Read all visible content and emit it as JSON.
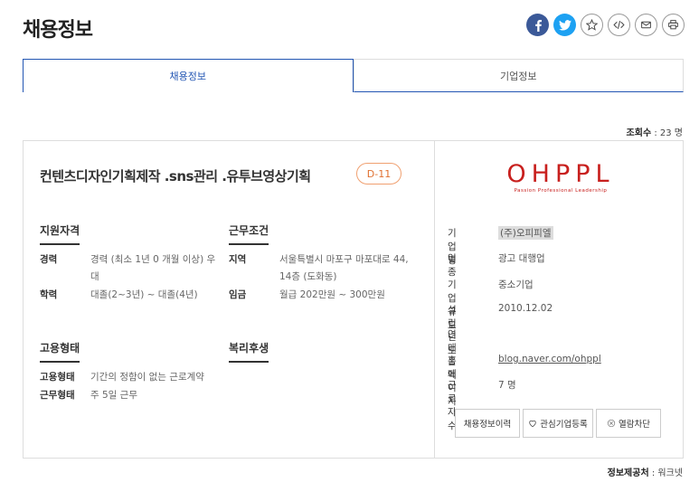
{
  "page": {
    "title": "채용정보"
  },
  "share": {
    "icons": [
      "facebook-icon",
      "twitter-icon",
      "star-icon",
      "code-icon",
      "mail-icon",
      "print-icon"
    ],
    "colors": {
      "facebook": "#3b5998",
      "twitter": "#1da1f2"
    }
  },
  "tabs": [
    {
      "label": "채용정보",
      "active": true
    },
    {
      "label": "기업정보",
      "active": false
    }
  ],
  "views": {
    "label": "조회수",
    "value": ": 23 명"
  },
  "job": {
    "title": "컨텐츠디자인기획제작 .sns관리 .유투브영상기획",
    "dday": "D-11",
    "sections": {
      "qualification": {
        "heading": "지원자격",
        "career_label": "경력",
        "career_value_1": "경력 (최소 1년 0 개월 이상) 우",
        "career_value_2": "대",
        "edu_label": "학력",
        "edu_value": "대졸(2~3년) ~ 대졸(4년)"
      },
      "conditions": {
        "heading": "근무조건",
        "region_label": "지역",
        "region_value_1": "서울특별시 마포구 마포대로 44,",
        "region_value_2": "14층 (도화동)",
        "wage_label": "임금",
        "wage_value": "월급 202만원 ~ 300만원"
      },
      "employment": {
        "heading": "고용형태",
        "type_label": "고용형태",
        "type_value": "기간의 정함이 없는 근로계약",
        "work_label": "근무형태",
        "work_value": "주 5일 근무"
      },
      "welfare": {
        "heading": "복리후생"
      }
    }
  },
  "company": {
    "logo_main": "OHPPL",
    "logo_sub": "Passion Professional Leadership",
    "name_label": "기업명",
    "name_value": "(주)오피피엘",
    "industry_label": "업종",
    "industry_value": "광고 대행업",
    "size_label": "기업규모",
    "size_value": "중소기업",
    "founded_label": "설립년도",
    "founded_value": "2010.12.02",
    "revenue_label": "연매출액",
    "revenue_value": "",
    "homepage_label": "홈페이지",
    "homepage_value": "blog.naver.com/ohppl",
    "employees_label": "근로자수",
    "employees_value": "7 명",
    "accent_color": "#c8201e"
  },
  "buttons": {
    "history": "채용정보이력",
    "favorite": "관심기업등록",
    "block": "열람차단"
  },
  "source": {
    "label": "정보제공처",
    "value": ": 워크넷"
  }
}
